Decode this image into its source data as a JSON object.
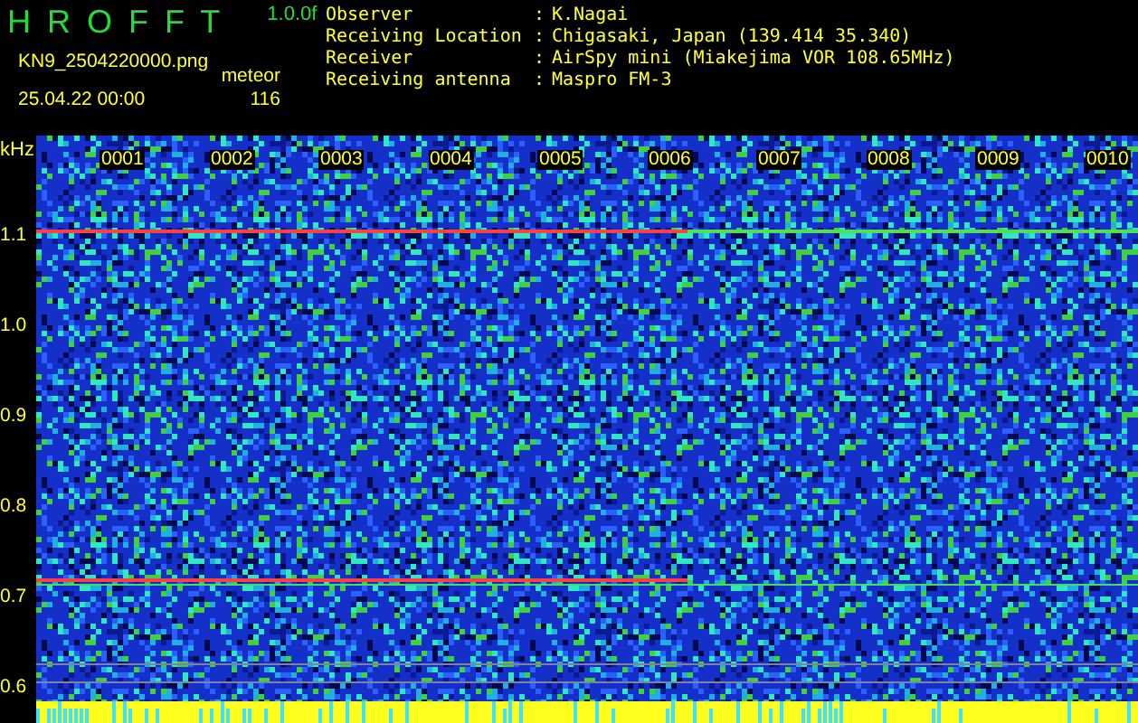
{
  "app": {
    "title": "H R O F F T",
    "version": "1.0.0f"
  },
  "file": "KN9_2504220000.png",
  "datetime": "25.04.22 00:00",
  "meteor": {
    "label": "meteor",
    "count": "116"
  },
  "info": [
    {
      "label": "Observer",
      "separator": ":",
      "value": "K.Nagai"
    },
    {
      "label": "Receiving Location",
      "separator": ":",
      "value": "Chigasaki, Japan (139.414 35.340)"
    },
    {
      "label": "Receiver",
      "separator": ":",
      "value": "AirSpy mini (Miakejima VOR 108.65MHz)"
    },
    {
      "label": "Receiving antenna",
      "separator": ":",
      "value": "Maspro FM-3"
    }
  ],
  "y_axis": {
    "unit": "kHz",
    "labels": [
      "1.1",
      "1.0",
      "0.9",
      "0.8",
      "0.7",
      "0.6"
    ]
  },
  "time_labels": [
    "0001",
    "0002",
    "0003",
    "0004",
    "0005",
    "0006",
    "0007",
    "0008",
    "0009",
    "0010"
  ]
}
